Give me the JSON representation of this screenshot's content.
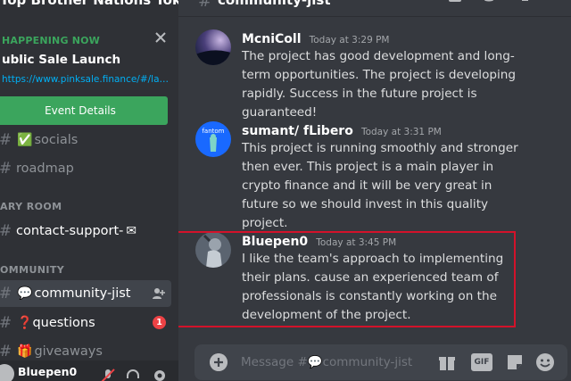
{
  "server": {
    "name": "Top Brother Nations Tok..."
  },
  "event": {
    "status": "HAPPENING NOW",
    "title": "ublic Sale Launch",
    "link": "https://www.pinksale.finance/#/launchpad",
    "button_label": "Event Details"
  },
  "channels": {
    "socials": {
      "label": "socials",
      "emoji": "✅"
    },
    "roadmap": {
      "label": "roadmap"
    },
    "category_room": "ARY ROOM",
    "contact_support": {
      "label": "contact-support-",
      "emoji": "✉"
    },
    "category_community": "OMMUNITY",
    "community_jist": {
      "label": "community-jist",
      "emoji": "💬"
    },
    "questions": {
      "label": "questions",
      "emoji": "❓",
      "badge": "1"
    },
    "giveaways": {
      "label": "giveaways",
      "emoji": "🎁"
    }
  },
  "user": {
    "name": "Bluepen0"
  },
  "header": {
    "channel_name": "community-jist"
  },
  "messages": [
    {
      "author": "McniColl",
      "time": "Today at 3:29 PM",
      "text": "The project has good development and long-term opportunities. The project is developing rapidly. Success in the future project is guaranteed!"
    },
    {
      "author": "sumant/ fLibero",
      "time": "Today at 3:31 PM",
      "text": "This project is running smoothly and stronger then ever. This project is a main player in crypto finance and it will be very great in future so we should invest in this quality project.",
      "avatar_text": "fantom"
    },
    {
      "author": "Bluepen0",
      "time": "Today at 3:45 PM",
      "text": "I like the team's approach to implementing their plans.  cause an experienced team of professionals is constantly working on the development of the project."
    }
  ],
  "composer": {
    "placeholder": "Message #💬community-jist",
    "gif_label": "GIF"
  },
  "colors": {
    "accent_green": "#3ba55d",
    "link": "#00aff4",
    "highlight_border": "#d3122a",
    "badge_red": "#ed4245"
  }
}
